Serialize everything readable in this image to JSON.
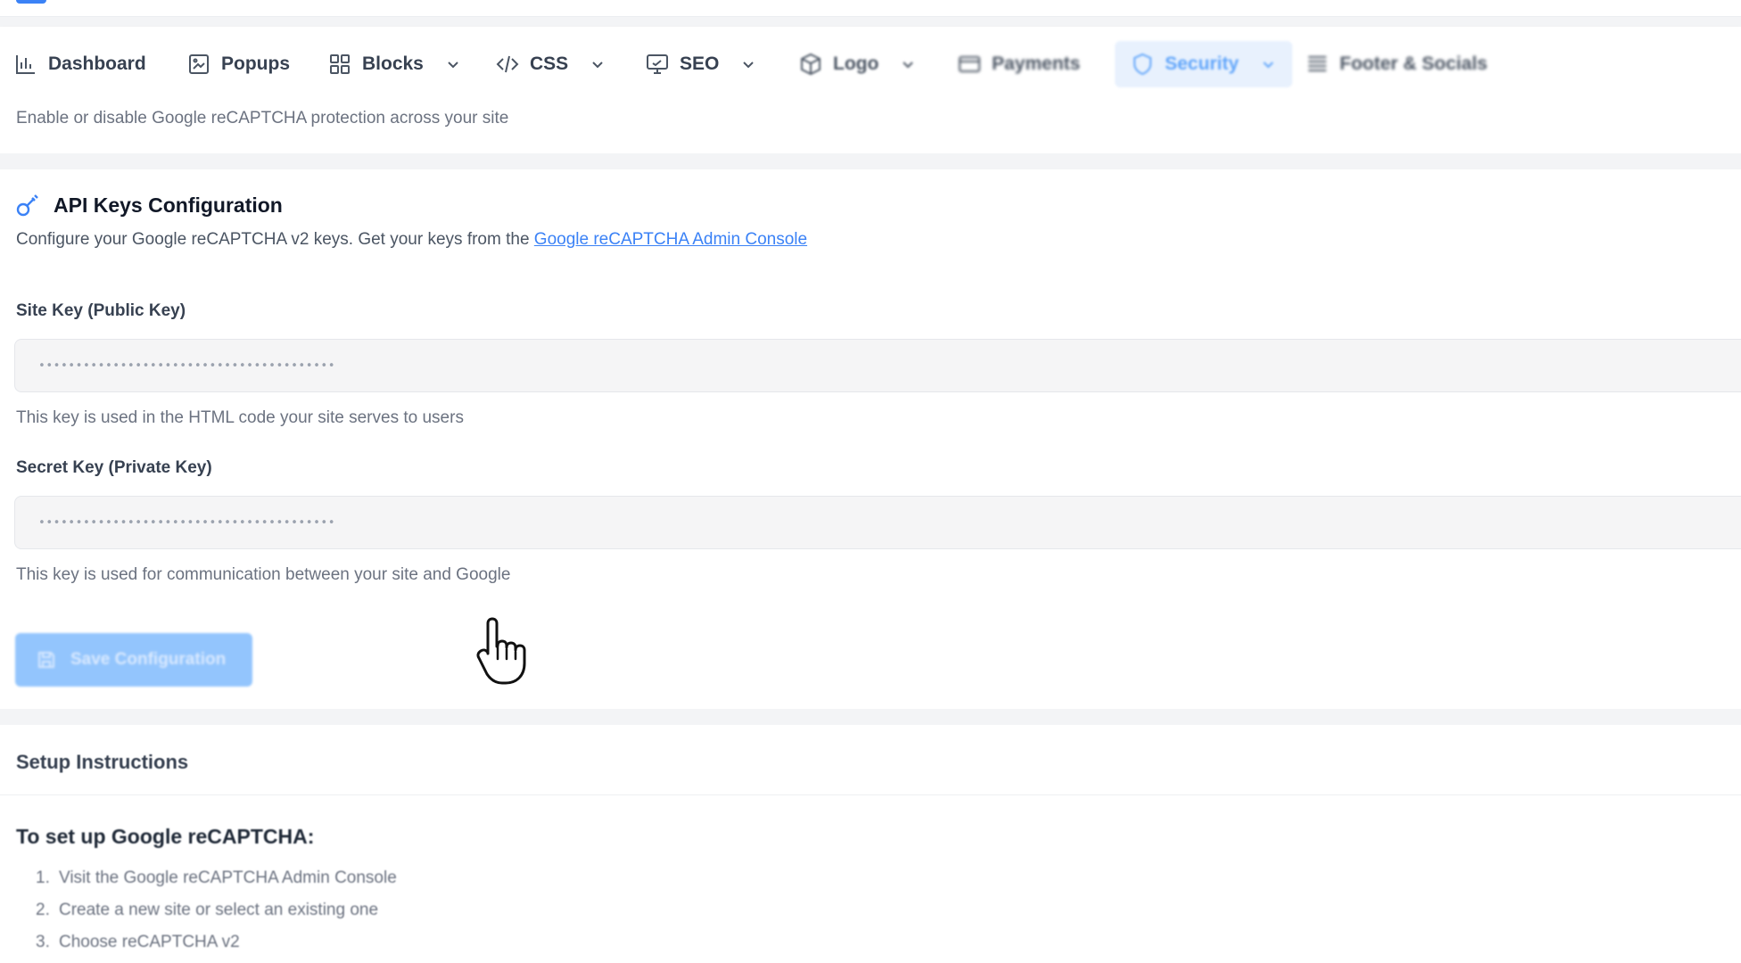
{
  "nav": {
    "items": [
      {
        "label": "Dashboard",
        "icon": "bar-chart-icon",
        "dropdown": false
      },
      {
        "label": "Popups",
        "icon": "popup-icon",
        "dropdown": false
      },
      {
        "label": "Blocks",
        "icon": "grid-icon",
        "dropdown": true
      },
      {
        "label": "CSS",
        "icon": "code-icon",
        "dropdown": true
      },
      {
        "label": "SEO",
        "icon": "monitor-icon",
        "dropdown": true
      },
      {
        "label": "Logo",
        "icon": "cube-icon",
        "dropdown": true
      },
      {
        "label": "Payments",
        "icon": "card-icon",
        "dropdown": false
      },
      {
        "label": "Security",
        "icon": "shield-icon",
        "dropdown": true,
        "active": true
      },
      {
        "label": "Footer & Socials",
        "icon": "stack-icon",
        "dropdown": false
      }
    ]
  },
  "recaptcha_toggle": {
    "description": "Enable or disable Google reCAPTCHA protection across your site"
  },
  "api_keys": {
    "title": "API Keys Configuration",
    "icon": "key-icon",
    "description": "Configure your Google reCAPTCHA v2 keys. Get your keys from the",
    "link_text": "Google reCAPTCHA Admin Console",
    "site_key": {
      "label": "Site Key (Public Key)",
      "value": "••••••••••••••••••••••••••••••••••••••••",
      "help": "This key is used in the HTML code your site serves to users"
    },
    "secret_key": {
      "label": "Secret Key (Private Key)",
      "value": "••••••••••••••••••••••••••••••••••••••••",
      "help": "This key is used for communication between your site and Google"
    },
    "save_button": "Save Configuration"
  },
  "setup": {
    "title": "Setup Instructions",
    "subtitle": "To set up Google reCAPTCHA:",
    "steps": [
      {
        "num": "1.",
        "text": "Visit the Google reCAPTCHA Admin Console"
      },
      {
        "num": "2.",
        "text": "Create a new site or select an existing one"
      },
      {
        "num": "3.",
        "text": "Choose reCAPTCHA v2"
      }
    ]
  },
  "colors": {
    "accent": "#3b82f6",
    "active_tab_bg": "#e8f1fd",
    "button_disabled": "#93c5fd"
  }
}
